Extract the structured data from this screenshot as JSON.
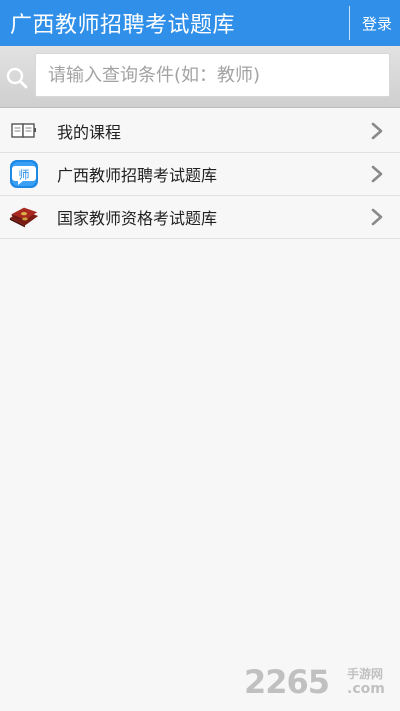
{
  "header": {
    "title": "广西教师招聘考试题库",
    "login_label": "登录"
  },
  "search": {
    "placeholder": "请输入查询条件(如：教师)",
    "value": ""
  },
  "list": {
    "items": [
      {
        "label": "我的课程",
        "icon": "book-icon"
      },
      {
        "label": "广西教师招聘考试题库",
        "icon": "teacher-app-icon",
        "icon_text": "师"
      },
      {
        "label": "国家教师资格考试题库",
        "icon": "certificate-books-icon"
      }
    ]
  },
  "watermark": {
    "main": "2265",
    "sub": "手游网",
    "com": ".com"
  },
  "colors": {
    "brand_blue": "#2f8fe9",
    "background": "#f7f7f7"
  }
}
